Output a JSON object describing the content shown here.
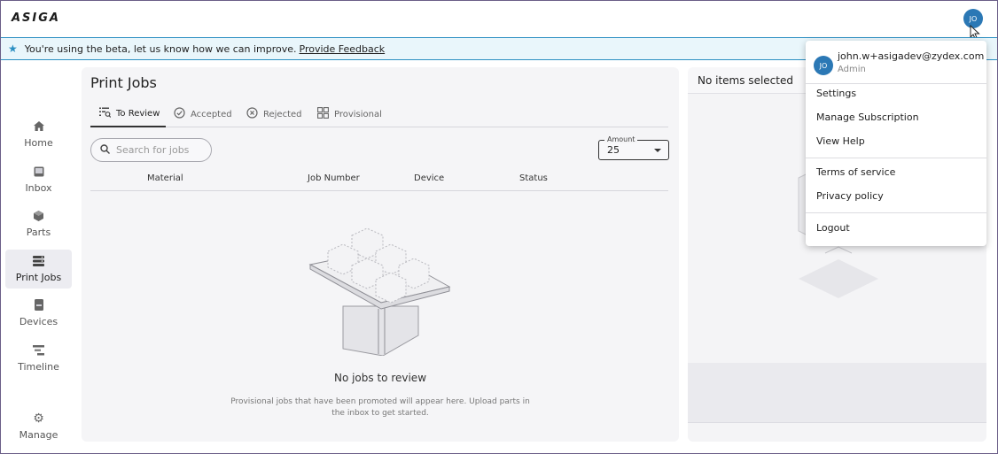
{
  "header": {
    "logo": "ASIGA",
    "avatar_initials": "JO"
  },
  "banner": {
    "message": "You're using the beta, let us know how we can improve.",
    "link": "Provide Feedback"
  },
  "sidebar": {
    "items": [
      {
        "label": "Home",
        "icon": "home-icon"
      },
      {
        "label": "Inbox",
        "icon": "inbox-icon"
      },
      {
        "label": "Parts",
        "icon": "cube-icon"
      },
      {
        "label": "Print Jobs",
        "icon": "print-jobs-icon",
        "active": true
      },
      {
        "label": "Devices",
        "icon": "printer-icon"
      },
      {
        "label": "Timeline",
        "icon": "timeline-icon"
      },
      {
        "label": "Manage",
        "icon": "gear-icon"
      }
    ]
  },
  "main": {
    "title": "Print Jobs",
    "tabs": [
      {
        "label": "To Review",
        "active": true
      },
      {
        "label": "Accepted"
      },
      {
        "label": "Rejected"
      },
      {
        "label": "Provisional"
      }
    ],
    "search_placeholder": "Search for jobs",
    "amount": {
      "label": "Amount",
      "value": "25"
    },
    "columns": [
      "Material",
      "Job Number",
      "Device",
      "Status"
    ],
    "empty": {
      "title": "No jobs to review",
      "description": "Provisional jobs that have been promoted will appear here. Upload parts in the inbox to get started."
    }
  },
  "detail": {
    "title": "No items selected"
  },
  "user_menu": {
    "initials": "JO",
    "email": "john.w+asigadev@zydex.com",
    "role": "Admin",
    "items": [
      "Settings",
      "Manage Subscription",
      "View Help",
      "Terms of service",
      "Privacy policy",
      "Logout"
    ]
  },
  "colors": {
    "accent": "#2b78b5",
    "banner_bg": "#e9f6fb",
    "banner_border": "#2b8fc2"
  }
}
